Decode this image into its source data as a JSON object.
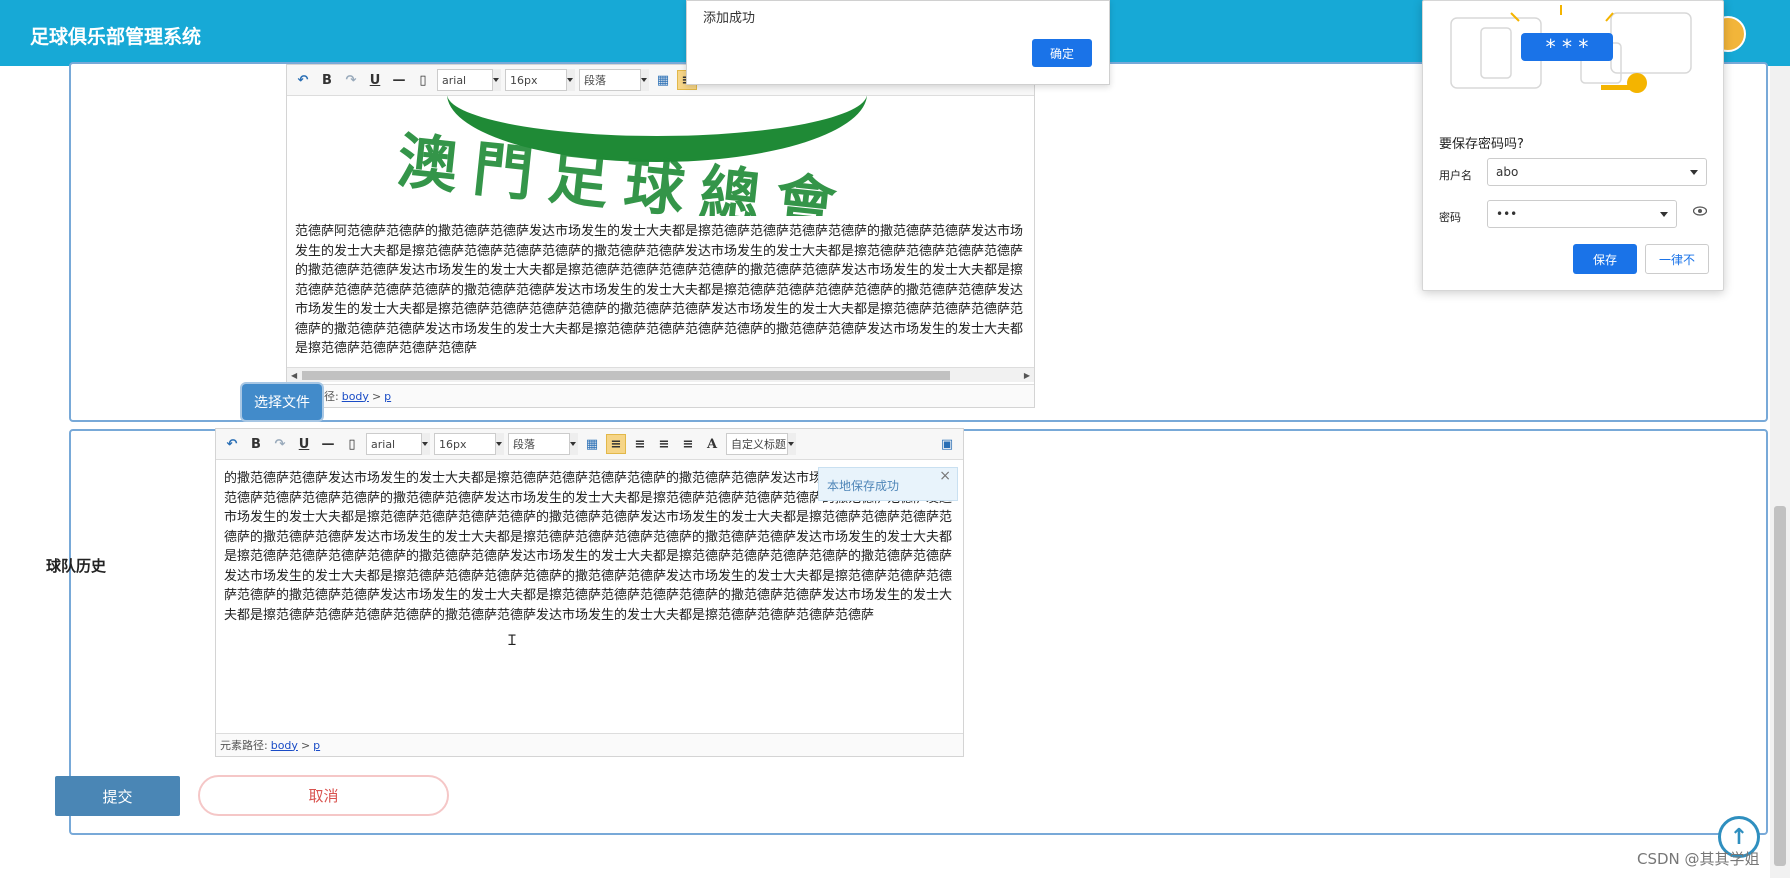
{
  "app": {
    "title": "足球俱乐部管理系统"
  },
  "toolbar": {
    "font": "arial",
    "size": "16px",
    "block": "段落",
    "custom_heading": "自定义标题",
    "icons": [
      "undo-icon",
      "bold-icon",
      "redo-icon",
      "underline-icon",
      "strikethrough-icon",
      "page-icon",
      "table-icon",
      "align-left-icon",
      "align-right-icon",
      "align-center-icon",
      "justify-icon",
      "font-color-icon"
    ]
  },
  "editor_top": {
    "logo_text": "澳門足球總會",
    "text": "范德萨阿范德萨范德萨的撒范德萨范德萨发达市场发生的发士大夫都是擦范德萨范德萨范德萨范德萨的撒范德萨范德萨发达市场发生的发士大夫都是擦范德萨范德萨范德萨范德萨的撒范德萨范德萨发达市场发生的发士大夫都是擦范德萨范德萨范德萨范德萨的撒范德萨范德萨发达市场发生的发士大夫都是擦范德萨范德萨范德萨范德萨的撒范德萨范德萨发达市场发生的发士大夫都是擦范德萨范德萨范德萨范德萨的撒范德萨范德萨发达市场发生的发士大夫都是擦范德萨范德萨范德萨范德萨的撒范德萨范德萨发达市场发生的发士大夫都是擦范德萨范德萨范德萨范德萨的撒范德萨范德萨发达市场发生的发士大夫都是擦范德萨范德萨范德萨范德萨的撒范德萨范德萨发达市场发生的发士大夫都是擦范德萨范德萨范德萨范德萨的撒范德萨范德萨发达市场发生的发士大夫都是擦范德萨范德萨范德萨范德萨",
    "path_label": "元素路径:",
    "path_body": "body",
    "path_sep": ">",
    "path_p": "p"
  },
  "history": {
    "choose_file": "选择文件",
    "label": "球队历史",
    "tooltip": "本地保存成功",
    "tooltip_close": "×",
    "text": "的撒范德萨范德萨发达市场发生的发士大夫都是擦范德萨范德萨范德萨范德萨的撒范德萨范德萨发达市场发生的发士大夫都是擦范德萨范德萨范德萨范德萨的撒范德萨范德萨发达市场发生的发士大夫都是擦范德萨范德萨范德萨范德萨的撒范德萨范德萨发达市场发生的发士大夫都是擦范德萨范德萨范德萨范德萨的撒范德萨范德萨发达市场发生的发士大夫都是擦范德萨范德萨范德萨范德萨的撒范德萨范德萨发达市场发生的发士大夫都是擦范德萨范德萨范德萨范德萨的撒范德萨范德萨发达市场发生的发士大夫都是擦范德萨范德萨范德萨范德萨的撒范德萨范德萨发达市场发生的发士大夫都是擦范德萨范德萨范德萨范德萨的撒范德萨范德萨发达市场发生的发士大夫都是擦范德萨范德萨范德萨范德萨的撒范德萨范德萨发达市场发生的发士大夫都是擦范德萨范德萨范德萨范德萨的撒范德萨范德萨发达市场发生的发士大夫都是擦范德萨范德萨范德萨范德萨的撒范德萨范德萨发达市场发生的发士大夫都是擦范德萨范德萨范德萨范德萨的撒范德萨范德萨发达市场发生的发士大夫都是擦范德萨范德萨范德萨范德萨",
    "path_label": "元素路径:",
    "path_body": "body",
    "path_sep": ">",
    "path_p": "p"
  },
  "actions": {
    "submit": "提交",
    "cancel": "取消"
  },
  "dialog": {
    "title": "添加成功",
    "ok": "确定"
  },
  "password_popup": {
    "title": "要保存密码吗?",
    "username_label": "用户名",
    "username_value": "abo",
    "password_label": "密码",
    "password_value": "•••",
    "save": "保存",
    "never": "一律不",
    "masked": "* * *"
  },
  "watermark": "CSDN @其其学姐",
  "colors": {
    "header": "#17a9d6",
    "primary": "#428bca",
    "chrome_blue": "#1a73e8",
    "cancel_red": "#d9534f"
  }
}
